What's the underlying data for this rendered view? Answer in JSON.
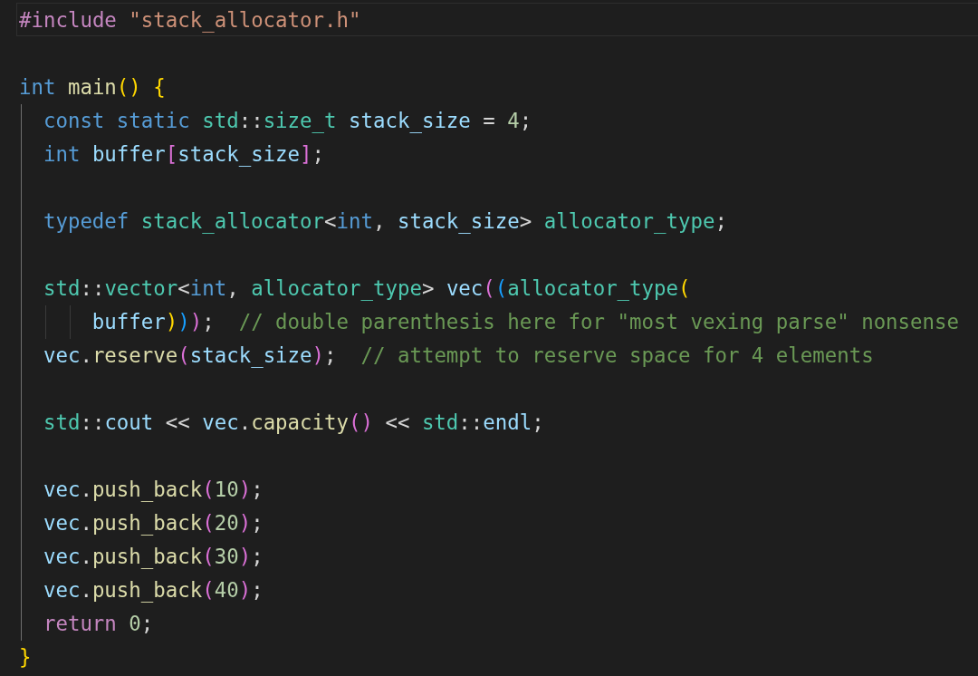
{
  "lines": [
    {
      "current": true,
      "tokens": [
        {
          "text": "#include ",
          "kind": "preprocessor"
        },
        {
          "text": "\"stack_allocator.h\"",
          "kind": "string"
        }
      ]
    },
    {
      "current": false
    },
    {
      "current": false,
      "tokens": [
        {
          "text": "int ",
          "kind": "keyword"
        },
        {
          "text": "main",
          "kind": "function"
        },
        {
          "text": "() {",
          "kind": "bracket1"
        }
      ],
      "children": [
        {
          "current": false,
          "continuation": false,
          "tokens": [
            {
              "text": "const ",
              "kind": "keyword"
            },
            {
              "text": "static ",
              "kind": "keyword"
            },
            {
              "text": "std",
              "kind": "type"
            },
            {
              "text": "::",
              "kind": "plain"
            },
            {
              "text": "size_t ",
              "kind": "type"
            },
            {
              "text": "stack_size",
              "kind": "variable"
            },
            {
              "text": " = ",
              "kind": "plain"
            },
            {
              "text": "4",
              "kind": "number"
            },
            {
              "text": ";",
              "kind": "plain"
            }
          ]
        },
        {
          "current": false,
          "continuation": false,
          "tokens": [
            {
              "text": "int ",
              "kind": "keyword"
            },
            {
              "text": "buffer",
              "kind": "variable"
            },
            {
              "text": "[",
              "kind": "bracket2"
            },
            {
              "text": "stack_size",
              "kind": "variable"
            },
            {
              "text": "]",
              "kind": "bracket2"
            },
            {
              "text": ";",
              "kind": "plain"
            }
          ]
        },
        {
          "current": false,
          "continuation": false
        },
        {
          "current": false,
          "continuation": false,
          "tokens": [
            {
              "text": "typedef ",
              "kind": "keyword"
            },
            {
              "text": "stack_allocator",
              "kind": "type"
            },
            {
              "text": "<",
              "kind": "plain"
            },
            {
              "text": "int",
              "kind": "keyword"
            },
            {
              "text": ", ",
              "kind": "plain"
            },
            {
              "text": "stack_size",
              "kind": "variable"
            },
            {
              "text": "> ",
              "kind": "plain"
            },
            {
              "text": "allocator_type",
              "kind": "type"
            },
            {
              "text": ";",
              "kind": "plain"
            }
          ]
        },
        {
          "current": false,
          "continuation": false
        },
        {
          "current": false,
          "continuation": false,
          "tokens": [
            {
              "text": "std",
              "kind": "type"
            },
            {
              "text": "::",
              "kind": "plain"
            },
            {
              "text": "vector",
              "kind": "type"
            },
            {
              "text": "<",
              "kind": "plain"
            },
            {
              "text": "int",
              "kind": "keyword"
            },
            {
              "text": ", ",
              "kind": "plain"
            },
            {
              "text": "allocator_type",
              "kind": "type"
            },
            {
              "text": "> ",
              "kind": "plain"
            },
            {
              "text": "vec",
              "kind": "variable"
            },
            {
              "text": "(",
              "kind": "bracket2"
            },
            {
              "text": "(",
              "kind": "bracket3"
            },
            {
              "text": "allocator_type",
              "kind": "type"
            },
            {
              "text": "(",
              "kind": "bracket1"
            }
          ]
        },
        {
          "current": false,
          "continuation": true,
          "tokens": [
            {
              "text": "buffer",
              "kind": "variable"
            },
            {
              "text": ")",
              "kind": "bracket1"
            },
            {
              "text": ")",
              "kind": "bracket3"
            },
            {
              "text": ")",
              "kind": "bracket2"
            },
            {
              "text": ";  ",
              "kind": "plain"
            },
            {
              "text": "// double parenthesis here for \"most vexing parse\" nonsense",
              "kind": "comment"
            }
          ]
        },
        {
          "current": false,
          "continuation": false,
          "tokens": [
            {
              "text": "vec",
              "kind": "variable"
            },
            {
              "text": ".",
              "kind": "plain"
            },
            {
              "text": "reserve",
              "kind": "function"
            },
            {
              "text": "(",
              "kind": "bracket2"
            },
            {
              "text": "stack_size",
              "kind": "variable"
            },
            {
              "text": ")",
              "kind": "bracket2"
            },
            {
              "text": ";  ",
              "kind": "plain"
            },
            {
              "text": "// attempt to reserve space for 4 elements",
              "kind": "comment"
            }
          ]
        },
        {
          "current": false,
          "continuation": false
        },
        {
          "current": false,
          "continuation": false,
          "tokens": [
            {
              "text": "std",
              "kind": "type"
            },
            {
              "text": "::",
              "kind": "plain"
            },
            {
              "text": "cout",
              "kind": "variable"
            },
            {
              "text": " << ",
              "kind": "plain"
            },
            {
              "text": "vec",
              "kind": "variable"
            },
            {
              "text": ".",
              "kind": "plain"
            },
            {
              "text": "capacity",
              "kind": "function"
            },
            {
              "text": "()",
              "kind": "bracket2"
            },
            {
              "text": " << ",
              "kind": "plain"
            },
            {
              "text": "std",
              "kind": "type"
            },
            {
              "text": "::",
              "kind": "plain"
            },
            {
              "text": "endl",
              "kind": "variable"
            },
            {
              "text": ";",
              "kind": "plain"
            }
          ]
        },
        {
          "current": false,
          "continuation": false
        },
        {
          "current": false,
          "continuation": false,
          "tokens": [
            {
              "text": "vec",
              "kind": "variable"
            },
            {
              "text": ".",
              "kind": "plain"
            },
            {
              "text": "push_back",
              "kind": "function"
            },
            {
              "text": "(",
              "kind": "bracket2"
            },
            {
              "text": "10",
              "kind": "number"
            },
            {
              "text": ")",
              "kind": "bracket2"
            },
            {
              "text": ";",
              "kind": "plain"
            }
          ]
        },
        {
          "current": false,
          "continuation": false,
          "tokens": [
            {
              "text": "vec",
              "kind": "variable"
            },
            {
              "text": ".",
              "kind": "plain"
            },
            {
              "text": "push_back",
              "kind": "function"
            },
            {
              "text": "(",
              "kind": "bracket2"
            },
            {
              "text": "20",
              "kind": "number"
            },
            {
              "text": ")",
              "kind": "bracket2"
            },
            {
              "text": ";",
              "kind": "plain"
            }
          ]
        },
        {
          "current": false,
          "continuation": false,
          "tokens": [
            {
              "text": "vec",
              "kind": "variable"
            },
            {
              "text": ".",
              "kind": "plain"
            },
            {
              "text": "push_back",
              "kind": "function"
            },
            {
              "text": "(",
              "kind": "bracket2"
            },
            {
              "text": "30",
              "kind": "number"
            },
            {
              "text": ")",
              "kind": "bracket2"
            },
            {
              "text": ";",
              "kind": "plain"
            }
          ]
        },
        {
          "current": false,
          "continuation": false,
          "tokens": [
            {
              "text": "vec",
              "kind": "variable"
            },
            {
              "text": ".",
              "kind": "plain"
            },
            {
              "text": "push_back",
              "kind": "function"
            },
            {
              "text": "(",
              "kind": "bracket2"
            },
            {
              "text": "40",
              "kind": "number"
            },
            {
              "text": ")",
              "kind": "bracket2"
            },
            {
              "text": ";",
              "kind": "plain"
            }
          ]
        },
        {
          "current": false,
          "continuation": false,
          "tokens": [
            {
              "text": "return ",
              "kind": "control"
            },
            {
              "text": "0",
              "kind": "number"
            },
            {
              "text": ";",
              "kind": "plain"
            }
          ]
        }
      ]
    },
    {
      "current": false,
      "tokens": [
        {
          "text": "}",
          "kind": "bracket1"
        }
      ]
    }
  ]
}
